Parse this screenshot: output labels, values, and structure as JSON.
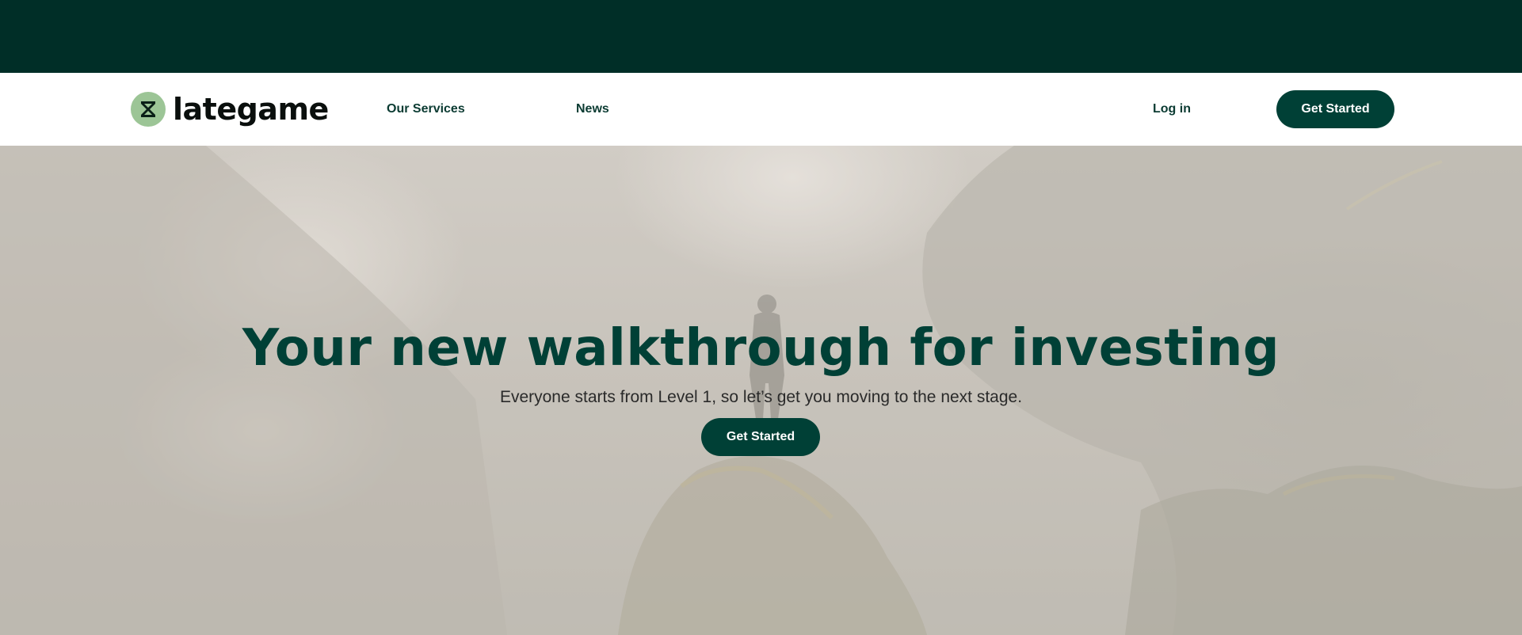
{
  "brand": {
    "name": "lategame",
    "logo_icon": "hourglass-icon",
    "accent_color": "#9cc596",
    "primary_color": "#004036",
    "top_band_color": "#002e27"
  },
  "nav": {
    "links": [
      {
        "label": "Our Services"
      },
      {
        "label": "News"
      }
    ],
    "login_label": "Log in",
    "cta_label": "Get Started"
  },
  "hero": {
    "title": "Your new walkthrough for investing",
    "subtitle": "Everyone starts from Level 1, so let’s get you moving to the next stage.",
    "cta_label": "Get Started"
  }
}
